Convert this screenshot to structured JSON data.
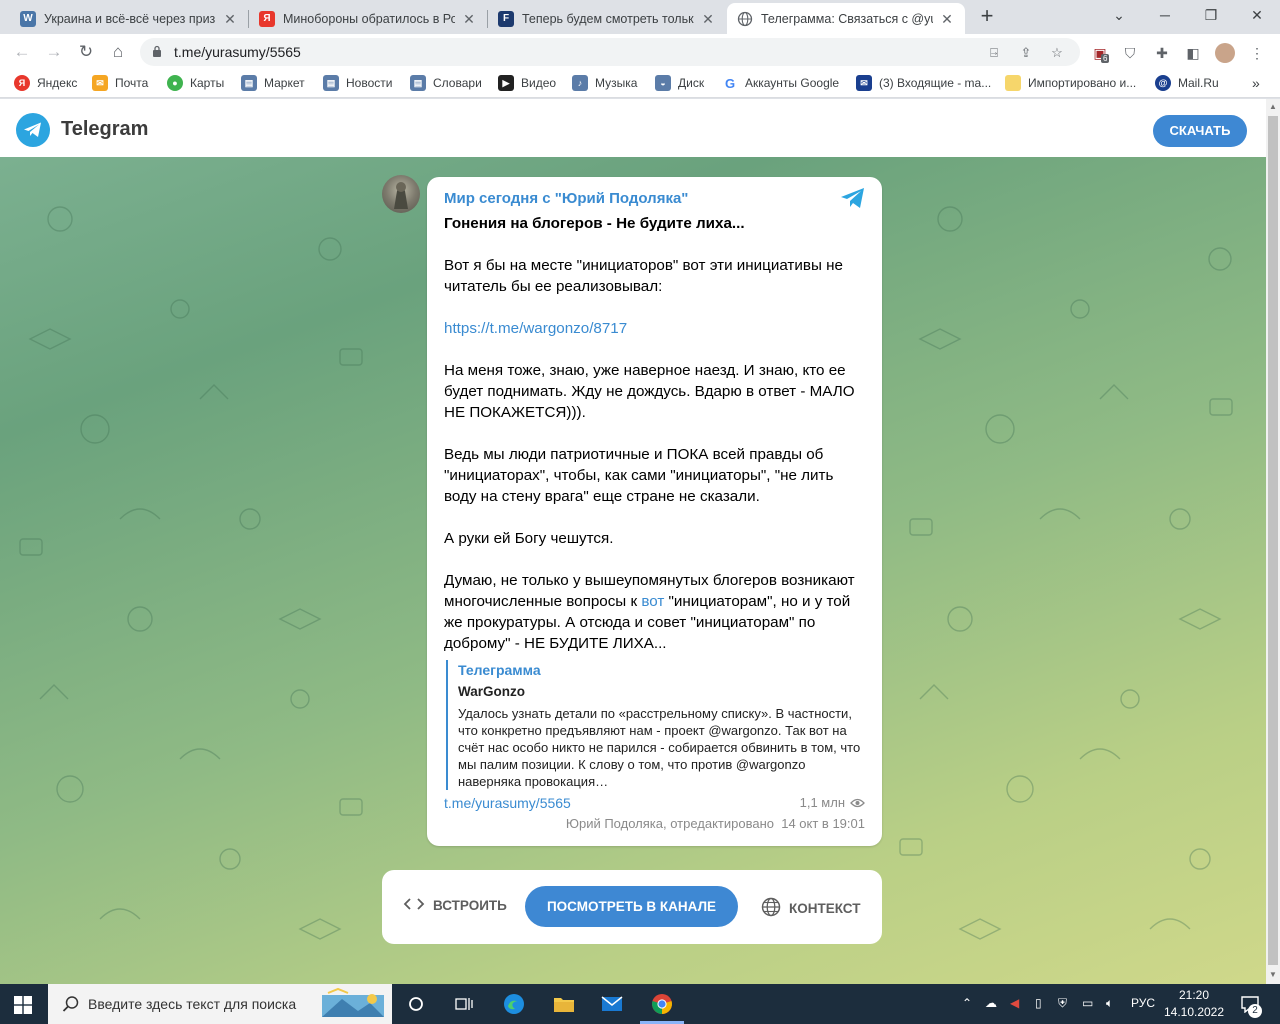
{
  "browser": {
    "tabs": [
      {
        "title": "Украина и всё-всё через призм",
        "favicon_color": "#4a76a8",
        "favicon_glyph": "W",
        "active": false
      },
      {
        "title": "Минобороны обратилось в Рос",
        "favicon_color": "#e8372c",
        "favicon_glyph": "Я",
        "active": false
      },
      {
        "title": "Теперь будем смотреть только",
        "favicon_color": "#1d3a6e",
        "favicon_glyph": "F",
        "active": false
      },
      {
        "title": "Телеграмма: Связаться с @yura",
        "favicon_color": "#5f6368",
        "favicon_glyph": "",
        "active": true
      }
    ],
    "url": "t.me/yurasumy/5565",
    "bookmarks": [
      {
        "label": "Яндекс",
        "color": "#e8372c",
        "glyph": "Я"
      },
      {
        "label": "Почта",
        "color": "#f5a623",
        "glyph": "✉"
      },
      {
        "label": "Карты",
        "color": "#3fb34f",
        "glyph": "●"
      },
      {
        "label": "Маркет",
        "color": "#5b7ca8",
        "glyph": "▤"
      },
      {
        "label": "Новости",
        "color": "#5b7ca8",
        "glyph": "▤"
      },
      {
        "label": "Словари",
        "color": "#5b7ca8",
        "glyph": "▤"
      },
      {
        "label": "Видео",
        "color": "#222222",
        "glyph": "▶"
      },
      {
        "label": "Музыка",
        "color": "#5b7ca8",
        "glyph": "♪"
      },
      {
        "label": "Диск",
        "color": "#5b7ca8",
        "glyph": "◒"
      },
      {
        "label": "Аккаунты Google",
        "color": "#ffffff",
        "glyph": "G"
      },
      {
        "label": "(3) Входящие - ma...",
        "color": "#1a3f8f",
        "glyph": "✉"
      },
      {
        "label": "Импортировано и...",
        "color": "#f6d66b",
        "glyph": ""
      },
      {
        "label": "Mail.Ru",
        "color": "#1a3f8f",
        "glyph": "@"
      }
    ],
    "extension_badge": "6"
  },
  "telegram": {
    "brand": "Telegram",
    "download_label": "СКАЧАТЬ",
    "post": {
      "channel": "Мир сегодня с \"Юрий Подоляка\"",
      "title": "Гонения на блогеров - Не будите лиха...",
      "p1": "Вот я бы на месте \"инициаторов\" вот эти инициативы не читатель бы ее реализовывал:",
      "link1": "https://t.me/wargonzo/8717",
      "p2": "На меня тоже, знаю, уже наверное наезд. И знаю, кто ее будет поднимать. Жду не дождусь. Вдарю в ответ - МАЛО НЕ ПОКАЖЕТСЯ))).",
      "p3": "Ведь мы люди патриотичные и ПОКА всей правды об \"инициаторах\", чтобы, как сами \"инициаторы\", \"не лить воду на стену врага\" еще стране не сказали.",
      "p4": "А руки ей Богу чешутся.",
      "p5_before": "Думаю, не только у вышеупомянутых блогеров возникают многочисленные вопросы к ",
      "p5_link": "вот",
      "p5_after": " \"инициаторам\", но и у той же прокуратуры. А отсюда и совет \"инициаторам\" по доброму\" - НЕ БУДИТЕ ЛИХА...",
      "quote_source": "Телеграмма",
      "quote_author": "WarGonzo",
      "quote_text": "Удалось узнать детали по «расстрельному списку». В частности, что конкретно предъявляют нам - проект @wargonzo. Так вот на счёт нас особо никто не парился - собирается обвинить в том, что мы палим позиции. К слову о том, что против @wargonzo наверняка провокация…",
      "post_link": "t.me/yurasumy/5565",
      "views": "1,1 млн",
      "author_edited": "Юрий Подоляка, отредактировано",
      "date": "14 окт в 19:01"
    },
    "actions": {
      "embed": "ВСТРОИТЬ",
      "view_in_channel": "ПОСМОТРЕТЬ В КАНАЛЕ",
      "context": "КОНТЕКСТ"
    }
  },
  "taskbar": {
    "search_placeholder": "Введите здесь текст для поиска",
    "language": "РУС",
    "time": "21:20",
    "date": "14.10.2022",
    "notifications": "2"
  },
  "colors": {
    "accent": "#3e88d3",
    "link": "#3a8bd1",
    "telegram_blue": "#2ca5e0"
  }
}
